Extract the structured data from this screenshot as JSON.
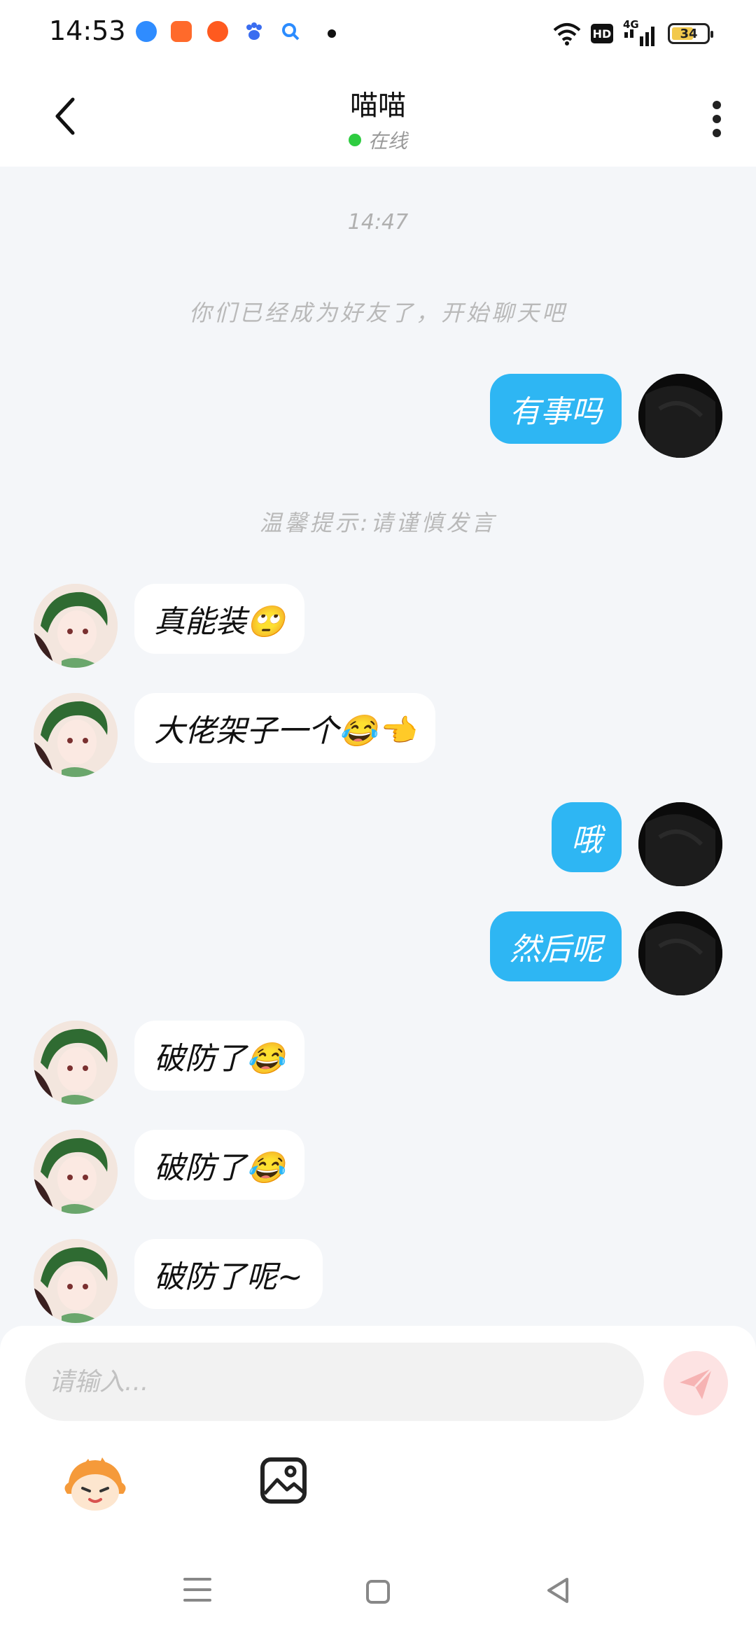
{
  "status_bar": {
    "time": "14:53",
    "network": "4G",
    "hd_label": "HD",
    "battery": "34",
    "app_icons": [
      "browser-icon",
      "kuaishou-icon",
      "weibo-icon",
      "baidu-icon",
      "search-app-icon"
    ],
    "app_colors": [
      "#2f8cff",
      "#ff6a2b",
      "#ff5a1f",
      "#3a6df0",
      "#2b8cff"
    ]
  },
  "header": {
    "title": "喵喵",
    "status": "在线",
    "status_color": "#2ecc40"
  },
  "chat": {
    "timestamp": "14:47",
    "friend_notice": "你们已经成为好友了，开始聊天吧",
    "warning_notice": "温馨提示:请谨慎发言",
    "messages": [
      {
        "side": "right",
        "text": "有事吗"
      },
      {
        "side": "left",
        "text": "真能装🙄"
      },
      {
        "side": "left",
        "text": "大佬架子一个😂👈"
      },
      {
        "side": "right",
        "text": "哦"
      },
      {
        "side": "right",
        "text": "然后呢"
      },
      {
        "side": "left",
        "text": "破防了😂"
      },
      {
        "side": "left",
        "text": "破防了😂"
      },
      {
        "side": "left",
        "text": "破防了呢~"
      }
    ]
  },
  "input": {
    "placeholder": "请输入..."
  },
  "colors": {
    "accent": "#2eb6f3",
    "send_button": "#fde3e3",
    "background": "#f4f6f9"
  }
}
